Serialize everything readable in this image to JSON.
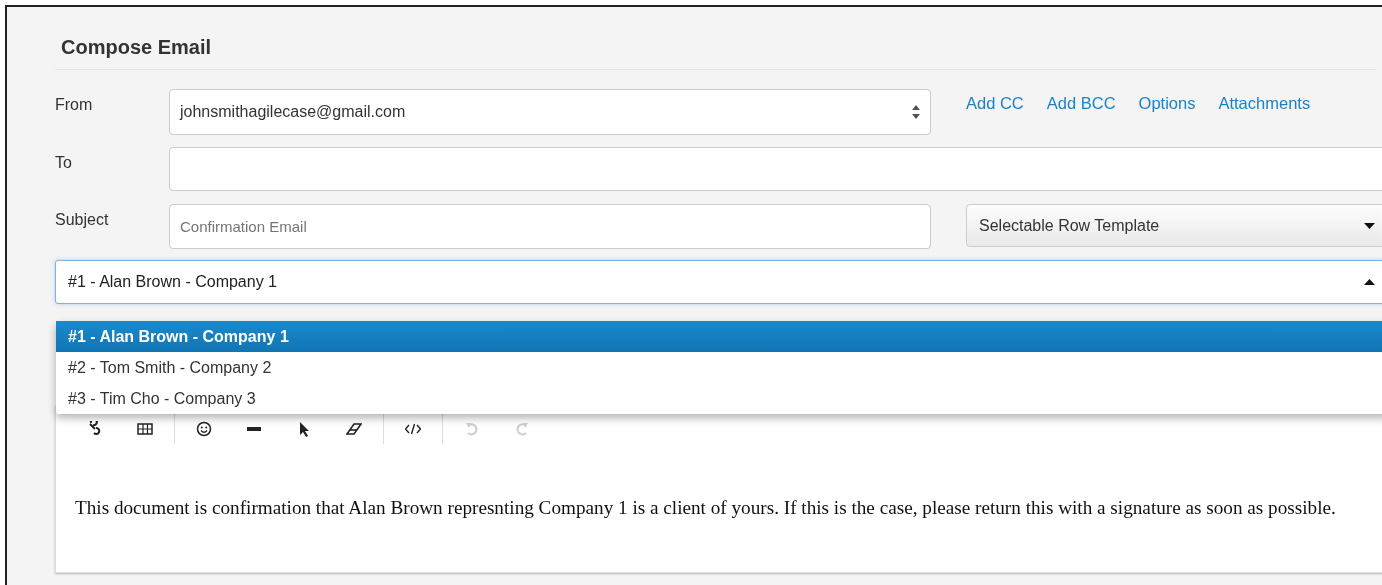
{
  "title": "Compose Email",
  "from": {
    "label": "From",
    "value": "johnsmithagilecase@gmail.com"
  },
  "links": [
    "Add CC",
    "Add BCC",
    "Options",
    "Attachments"
  ],
  "to": {
    "label": "To"
  },
  "subject": {
    "label": "Subject",
    "placeholder": "Confirmation Email"
  },
  "template_select": {
    "value": "Selectable Row Template"
  },
  "recipient_combo": {
    "value": "#1 - Alan Brown - Company 1",
    "expanded": true
  },
  "options": [
    {
      "label": "#1 - Alan Brown - Company 1",
      "selected": true
    },
    {
      "label": "#2 - Tom Smith - Company 2",
      "selected": false
    },
    {
      "label": "#3 - Tim Cho - Company 3",
      "selected": false
    }
  ],
  "toolbar": [
    [
      {
        "kind": "link",
        "disabled": false
      },
      {
        "kind": "table",
        "disabled": false
      }
    ],
    [
      {
        "kind": "emoji",
        "disabled": false
      },
      {
        "kind": "rule",
        "disabled": false
      },
      {
        "kind": "cursor",
        "disabled": false
      },
      {
        "kind": "eraser",
        "disabled": false
      }
    ],
    [
      {
        "kind": "code",
        "disabled": false
      }
    ],
    [
      {
        "kind": "undo",
        "disabled": true
      },
      {
        "kind": "redo",
        "disabled": true
      }
    ]
  ],
  "body": "This document is confirmation that Alan Brown represnting Company 1 is a client of yours. If this is the case, please return this with a signature as soon as possible."
}
